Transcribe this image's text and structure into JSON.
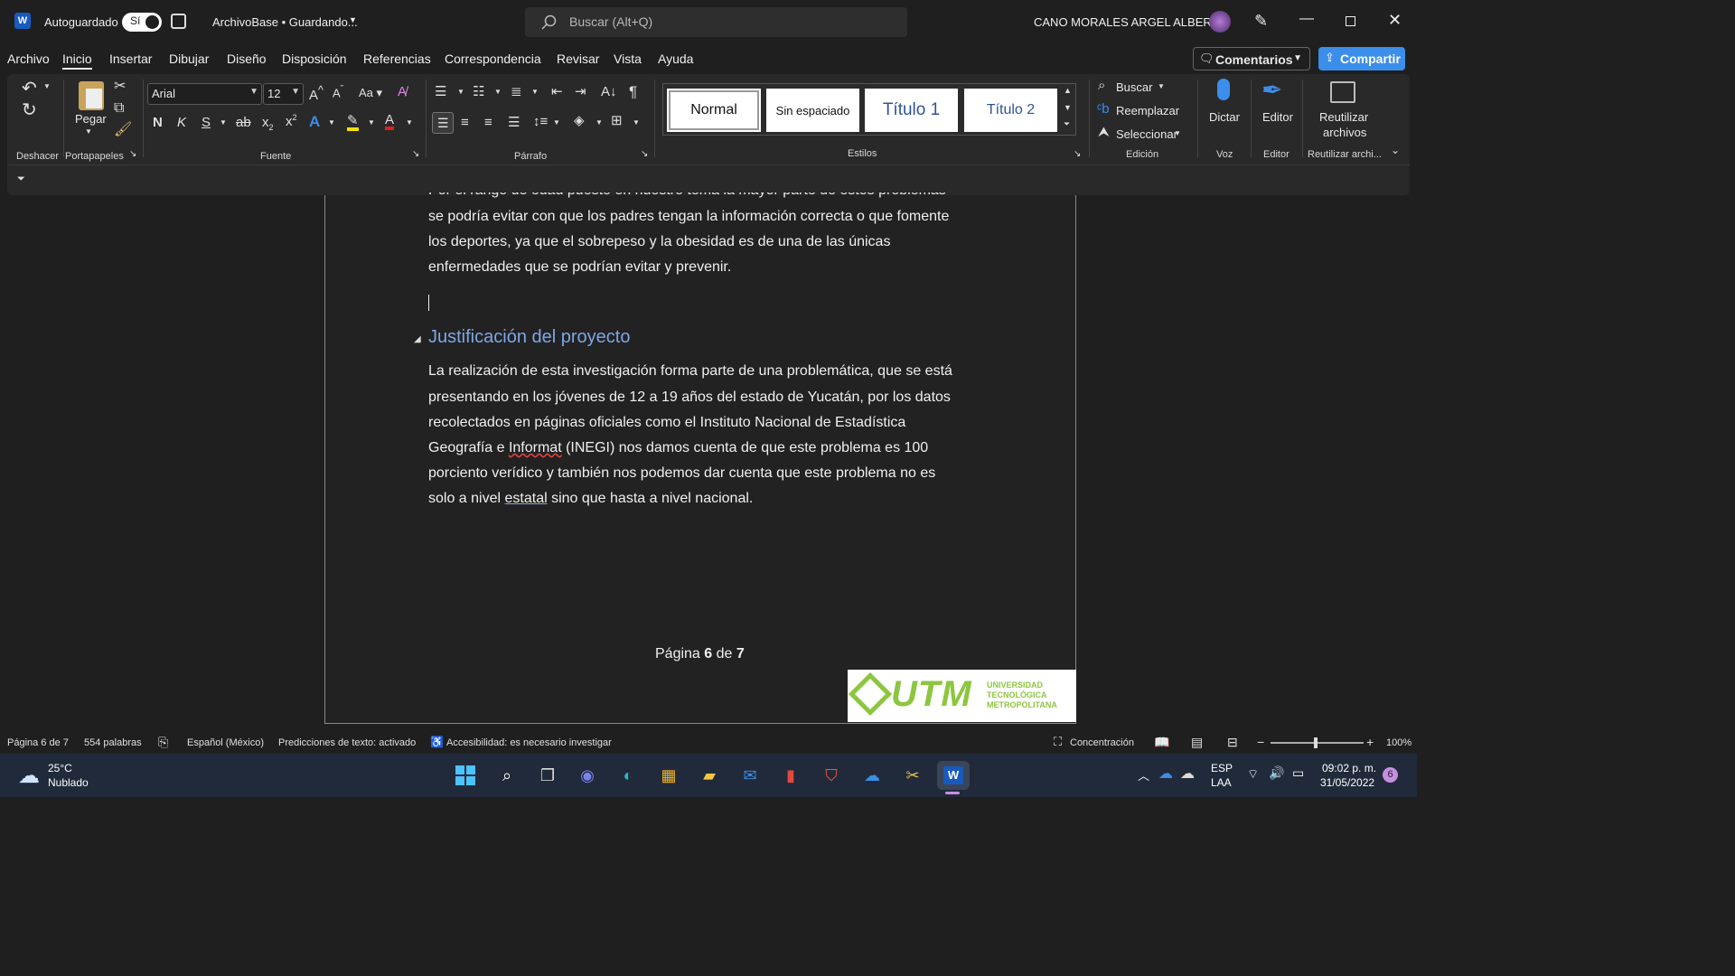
{
  "titlebar": {
    "autosave_label": "Autoguardado",
    "autosave_state": "Sí",
    "file_title": "ArchivoBase • Guardando...",
    "search_placeholder": "Buscar (Alt+Q)",
    "user_name": "CANO MORALES ARGEL ALBERTO"
  },
  "menubar": {
    "items": [
      "Archivo",
      "Inicio",
      "Insertar",
      "Dibujar",
      "Diseño",
      "Disposición",
      "Referencias",
      "Correspondencia",
      "Revisar",
      "Vista",
      "Ayuda"
    ],
    "active": "Inicio",
    "comments_label": "Comentarios",
    "share_label": "Compartir"
  },
  "ribbon": {
    "groups": {
      "undo": "Deshacer",
      "clipboard": "Portapapeles",
      "font": "Fuente",
      "paragraph": "Párrafo",
      "styles": "Estilos",
      "editing": "Edición",
      "voice": "Voz",
      "editor": "Editor",
      "reuse": "Reutilizar archi..."
    },
    "paste_label": "Pegar",
    "font_name": "Arial",
    "font_size": "12",
    "bold": "N",
    "italic": "K",
    "underline": "S",
    "styles": [
      "Normal",
      "Sin espaciado",
      "Título 1",
      "Título 2"
    ],
    "find_label": "Buscar",
    "replace_label": "Reemplazar",
    "select_label": "Seleccionar",
    "dictate_label": "Dictar",
    "editor_label": "Editor",
    "reuse_label_1": "Reutilizar",
    "reuse_label_2": "archivos"
  },
  "document": {
    "para1_line0": "Por el rango de edad puesto en nuestro tema la mayor parte de estos problemas",
    "para1_line1": "se podría evitar con que los padres tengan la información correcta o que fomente",
    "para1_line2": "los deportes, ya que el sobrepeso y la obesidad es de una de las únicas",
    "para1_line3": "enfermedades que se podrían evitar y prevenir.",
    "heading": "Justificación del proyecto",
    "para2_line1": "La realización de esta investigación forma parte de una problemática, que se está",
    "para2_line2": "presentando en los jóvenes de 12 a 19 años del estado de Yucatán, por los datos",
    "para2_line3": "recolectados en páginas oficiales como el Instituto Nacional de Estadística",
    "para2_line4_a": "Geografía e ",
    "para2_line4_b": "Informat",
    "para2_line4_c": " (INEGI) nos damos cuenta de que este problema es 100",
    "para2_line5": "porciento verídico y también nos podemos dar cuenta que este problema no es",
    "para2_line6_a": "solo a nivel ",
    "para2_line6_b": "estatal",
    "para2_line6_c": " sino que hasta a nivel nacional.",
    "footer_prefix": "Página ",
    "footer_page": "6",
    "footer_mid": " de ",
    "footer_total": "7",
    "logo_text": "UTM",
    "logo_sub1": "UNIVERSIDAD",
    "logo_sub2": "TECNOLÓGICA",
    "logo_sub3": "METROPOLITANA"
  },
  "statusbar": {
    "page": "Página 6 de 7",
    "words": "554 palabras",
    "language": "Español (México)",
    "predictions": "Predicciones de texto: activado",
    "accessibility": "Accesibilidad: es necesario investigar",
    "focus": "Concentración",
    "zoom": "100%"
  },
  "taskbar": {
    "weather_temp": "25°C",
    "weather_desc": "Nublado",
    "lang1": "ESP",
    "lang2": "LAA",
    "time": "09:02 p. m.",
    "date": "31/05/2022",
    "notif_count": "6"
  },
  "colors": {
    "accent": "#3b8eea",
    "heading": "#7ea6e6",
    "word_blue": "#185abd"
  }
}
